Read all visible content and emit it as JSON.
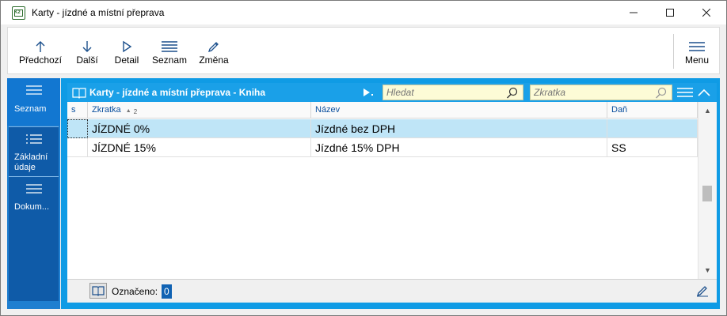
{
  "window": {
    "title": "Karty - jízdné a místní přeprava",
    "icon_text": "K2",
    "controls": {
      "minimize": "—",
      "maximize": "☐",
      "close": "✕"
    }
  },
  "toolbar": {
    "items": [
      {
        "label": "Předchozí",
        "icon": "arrow-up-icon"
      },
      {
        "label": "Další",
        "icon": "arrow-down-icon"
      },
      {
        "label": "Detail",
        "icon": "play-outline-icon"
      },
      {
        "label": "Seznam",
        "icon": "list-icon"
      },
      {
        "label": "Změna",
        "icon": "pencil-icon"
      }
    ],
    "menu_label": "Menu"
  },
  "sidebar": {
    "items": [
      {
        "label": "Seznam",
        "icon": "hamburger-icon",
        "active": true
      },
      {
        "label": "Základní údaje",
        "label_line1": "Základní",
        "label_line2": "údaje",
        "icon": "list-icon"
      },
      {
        "label": "Dokum...",
        "icon": "hamburger-icon"
      }
    ]
  },
  "panel": {
    "title": "Karty - jízdné a místní přeprava - Kniha",
    "search_placeholder": "Hledat",
    "shortcut_placeholder": "Zkratka"
  },
  "table": {
    "columns": [
      {
        "label": "s"
      },
      {
        "label": "Zkratka",
        "sort_indicator": "▲",
        "sort_index": "2"
      },
      {
        "label": "Název"
      },
      {
        "label": "Daň"
      }
    ],
    "rows": [
      {
        "zkratka": "JÍZDNÉ 0%",
        "nazev": "Jízdné bez DPH",
        "dan": "",
        "selected": true
      },
      {
        "zkratka": "JÍZDNÉ 15%",
        "nazev": "Jízdné 15% DPH",
        "dan": "SS",
        "selected": false
      }
    ]
  },
  "footer": {
    "marked_label": "Označeno:",
    "marked_count": "0"
  },
  "colors": {
    "accent": "#1aa0e8",
    "sidebar": "#1f7fd0",
    "selected_row": "#bfe5f7",
    "search_bg": "#fdfbd6"
  }
}
